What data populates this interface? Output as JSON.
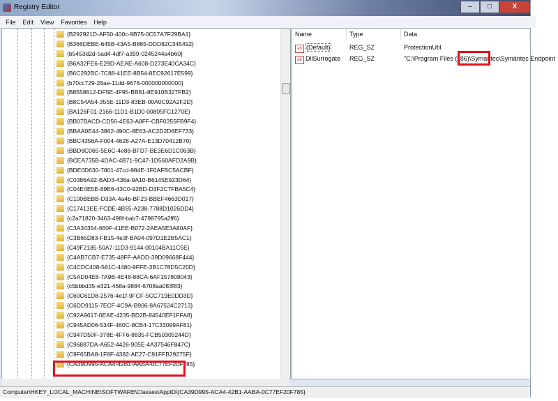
{
  "window": {
    "title": "Registry Editor",
    "minimize": "–",
    "maximize": "□",
    "close": "X"
  },
  "menu": [
    "File",
    "Edit",
    "View",
    "Favorites",
    "Help"
  ],
  "tree": {
    "items": [
      "{B292921D-AF50-400c-9B75-0C57A7F29BA1}",
      "{B366DEBE-645B-43A5-B865-DDD82C345492}",
      "{b5453d2d-5ad4-4df7-a399-0245244a4b60}",
      "{B6A32FE6-E29D-AEAE-A608-D273E40CA34C}",
      "{B6C292BC-7C88-41EE-8B54-8EC92617E599}",
      "{b70cc729-28ae-11dd-9676-000000000000}",
      "{B8558612-DF5E-4F95-BB81-8E910B327FB2}",
      "{B8C54A54-355E-11D3-83EB-00A0C92A2F2D}",
      "{BA126F01-2166-11D1-B1D0-00805FC1270E}",
      "{BB07BACD-CD56-4E63-A8FF-CBF0355FB9F4}",
      "{BBAA0E44-3862-490C-8E63-AC2D2D6EF733}",
      "{BBC4356A-F004-4628-A27A-E13D70412B70}",
      "{BBD8C065-5E6C-4e88-BFD7-BE3E6D1C063B}",
      "{BCEA735B-4DAC-4B71-9C47-1D560AFD2A9B}",
      "{BDE0D630-7801-47cd-984E-1F0AFBC5ACBF}",
      "{C0386A92-BAD3-436a-9A10-B6145E923D64}",
      "{C04E4E5E-89E6-43C0-92BD-D3F2C7FBA5C4}",
      "{C100BEBB-D33A-4a4b-BF23-BBEF4663D017}",
      "{C17413EE-FCDE-4B55-A238-7788D1026DD4}",
      "{c2a71820-3463-498f-bab7-4798795a2ff6}",
      "{C3A34354-660F-41EE-B072-2AEA5E3A80AF}",
      "{C3B65D83-FB15-4e3f-BA04-097D1E2B5AC1}",
      "{C49F2185-50A7-11D3-9144-00104BA11C5E}",
      "{C4AB7CB7-E735-48FF-AADD-39D09668F444}",
      "{C4CDC408-581C-4480-9FFE-3B1C78D5C20D}",
      "{C5AD04E8-7A9B-4E48-88CA-6AF157808043}",
      "{c5bbbd35-e321-468a-9884-6708aa083f83}",
      "{C60C61D8-2576-4e1f-9FCF-5CC719E0DD3D}",
      "{C6DD9115-7ECF-4C9A-B906-8A67524C2713}",
      "{C92A9617-0EAE-4235-BD2B-84540EF1FFA8}",
      "{C945AD06-534F-460C-8CB4-17C33099AF81}",
      "{C947D50F-378E-4FF6-8835-FCB50305244D}",
      "{C96887DA-A652-4426-905E-4A37546F847C}",
      "{C9F65BA8-1F8F-4382-AE27-C91FFB29275F}",
      "{CA39D995-ACA4-42B1-AABA-0C77EF20F785}"
    ]
  },
  "values": {
    "headers": {
      "name": "Name",
      "type": "Type",
      "data": "Data"
    },
    "rows": [
      {
        "name": "(Default)",
        "type": "REG_SZ",
        "data": "ProtectionUtil"
      },
      {
        "name": "DllSurrogate",
        "type": "REG_SZ",
        "data": "\"C:\\Program Files (x86)\\Symantec\\Symantec Endpoint"
      }
    ]
  },
  "status": "Computer\\HKEY_LOCAL_MACHINE\\SOFTWARE\\Classes\\AppID\\{CA39D995-ACA4-42B1-AABA-0C77EF20F785}",
  "colors": {
    "highlight": "#e3101a"
  }
}
